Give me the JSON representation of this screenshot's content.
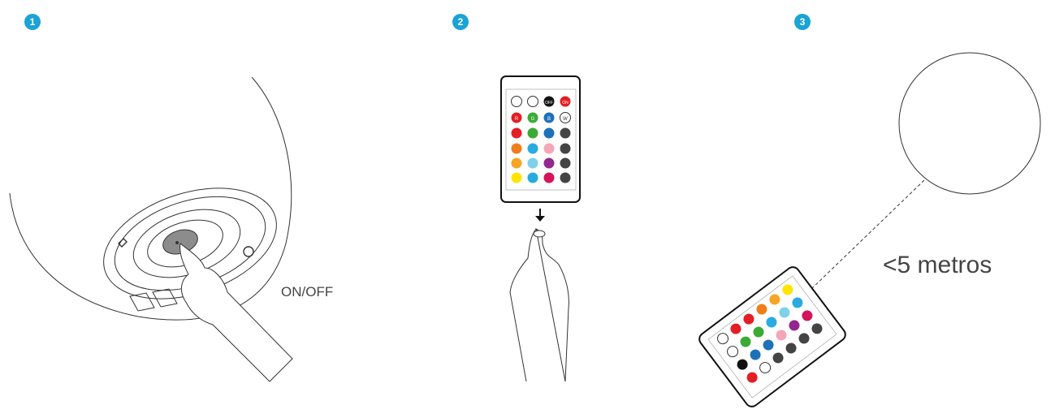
{
  "steps": [
    "1",
    "2",
    "3"
  ],
  "step1": {
    "label": "ON/OFF"
  },
  "step3": {
    "distance_label": "<5 metros"
  },
  "remote": {
    "row1": [
      "OFF",
      "ON"
    ],
    "row2": [
      "R",
      "G",
      "B",
      "W"
    ]
  },
  "colors": {
    "badge": "#1aa3d6",
    "red": "#e31e24",
    "green": "#3aaa35",
    "blue": "#1d71b8",
    "orange": "#ef7d1a",
    "cyan": "#29abe2",
    "pink": "#f4a6b7",
    "yellow": "#ffe500",
    "purple": "#93278f",
    "magenta": "#d5145a",
    "amber": "#f6a623",
    "grey": "#444444"
  }
}
